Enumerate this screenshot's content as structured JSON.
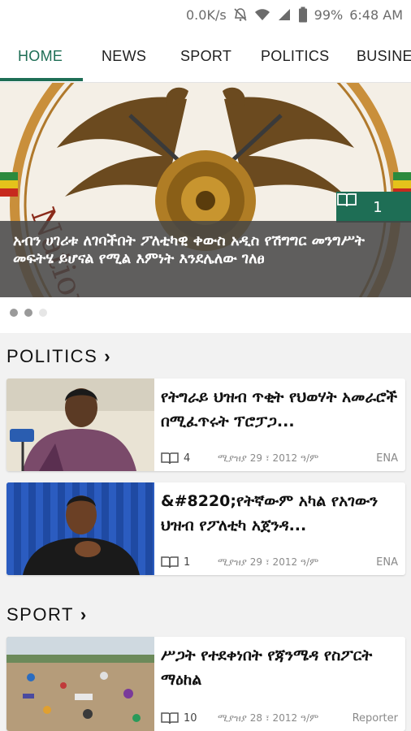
{
  "status_bar": {
    "speed": "0.0K/s",
    "battery_percent": "99%",
    "time": "6:48 AM",
    "icons": [
      "mute-icon",
      "wifi-icon",
      "signal-icon",
      "battery-icon"
    ]
  },
  "tabs": [
    {
      "label": "HOME",
      "active": true
    },
    {
      "label": "NEWS",
      "active": false
    },
    {
      "label": "SPORT",
      "active": false
    },
    {
      "label": "POLITICS",
      "active": false
    },
    {
      "label": "BUSINE",
      "active": false
    }
  ],
  "hero": {
    "count": "1",
    "headline": "አብን ሀገሪቱ ለገባችበት ፖለቲካዊ ቀውስ አዲስ የሽግግር መንግሥት መፍትሄ ይሆናል የሚል እምነት እንደሌለው ገለፀ",
    "image_text": "National Movement of Amhara",
    "carousel_pages": 3,
    "carousel_active": [
      true,
      true,
      false
    ]
  },
  "sections": [
    {
      "title": "POLITICS",
      "articles": [
        {
          "title": "የትግራይ ህዝብ ጥቂት የህወሃት አመራሮች በሚፈጥሩት ፕሮፓጋ...",
          "count": "4",
          "date": "ሚያዝያ 29 ፣ 2012 ዓ/ም",
          "source": "ENA"
        },
        {
          "title": "&#8220;የትኛውም አካል የአገውን ህዝብ የፖለቲካ አጀንዳ...",
          "count": "1",
          "date": "ሚያዝያ 29 ፣ 2012 ዓ/ም",
          "source": "ENA"
        }
      ]
    },
    {
      "title": "SPORT",
      "articles": [
        {
          "title": "ሥጋት የተደቀነበት የጃንሜዳ የስፖርት ማዕከል",
          "count": "10",
          "date": "ሚያዝያ 28 ፣ 2012 ዓ/ም",
          "source": "Reporter"
        }
      ]
    }
  ],
  "colors": {
    "accent": "#1e6e55",
    "caption_bg": "#464646"
  }
}
